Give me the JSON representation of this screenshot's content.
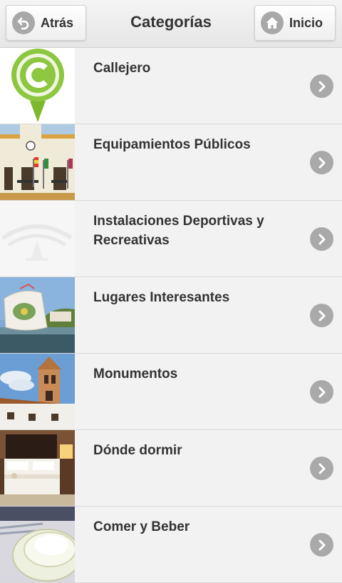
{
  "header": {
    "back_label": "Atrás",
    "title": "Categorías",
    "home_label": "Inicio"
  },
  "categories": [
    {
      "label": "Callejero",
      "thumb": "callejero-logo"
    },
    {
      "label": "Equipamientos Públicos",
      "thumb": "town-hall-photo"
    },
    {
      "label": "Instalaciones Deportivas y Recreativas",
      "thumb": "junta-logo-faded"
    },
    {
      "label": "Lugares Interesantes",
      "thumb": "monument-sculpture-photo"
    },
    {
      "label": "Monumentos",
      "thumb": "church-tower-photo"
    },
    {
      "label": "Dónde dormir",
      "thumb": "hotel-room-photo"
    },
    {
      "label": "Comer y Beber",
      "thumb": "plates-table-photo"
    }
  ],
  "colors": {
    "accent_green": "#8dc63f",
    "chevron_gray": "#a9a9a9",
    "text": "#333333"
  }
}
